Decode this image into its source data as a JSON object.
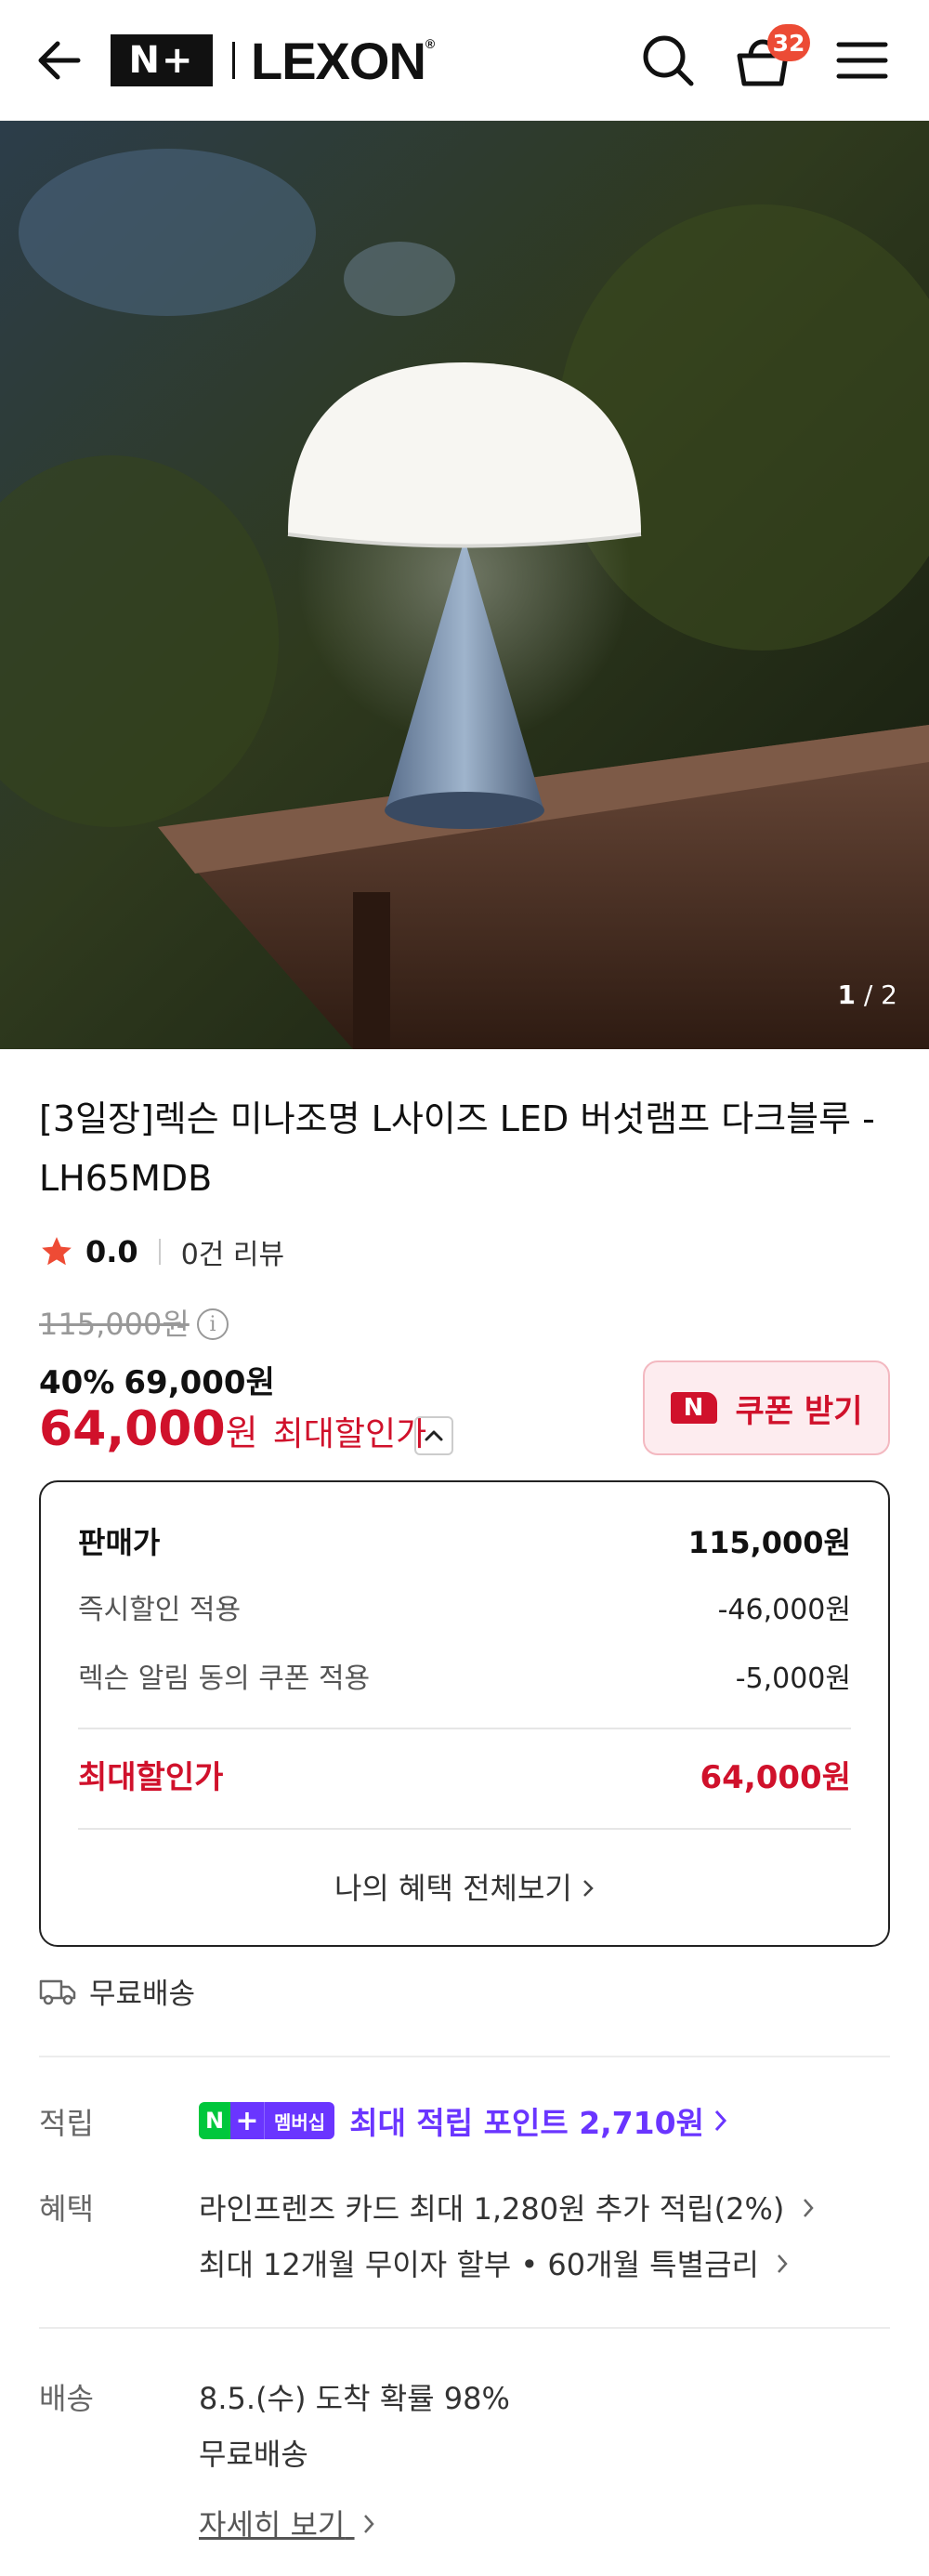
{
  "header": {
    "brand_np": "N+",
    "brand_name": "LEXON",
    "brand_reg": "®",
    "cart_count": "32",
    "icons": [
      "back-arrow-icon",
      "search-icon",
      "cart-basket-icon",
      "hamburger-menu-icon"
    ]
  },
  "hero": {
    "pager_current": "1",
    "pager_sep": "/",
    "pager_total": "2"
  },
  "product": {
    "title": "[3일장]렉슨 미나조명 L사이즈 LED 버섯램프 다크블루 - LH65MDB",
    "rating_score": "0.0",
    "review_count": "0건 리뷰",
    "original_price": "115,000원",
    "discount_pct": "40%",
    "sale_price": "69,000원",
    "max_price_amount": "64,000",
    "max_price_won": "원",
    "max_price_label": "최대할인가",
    "coupon_badge": "N",
    "coupon_button": "쿠폰 받기"
  },
  "breakdown": {
    "rows": [
      {
        "label": "판매가",
        "value": "115,000원"
      },
      {
        "label": "즉시할인 적용",
        "value": "-46,000원"
      },
      {
        "label": "렉슨 알림 동의 쿠폰 적용",
        "value": "-5,000원"
      },
      {
        "label": "최대할인가",
        "value": "64,000원"
      }
    ],
    "benefits_link": "나의 혜택 전체보기"
  },
  "shipping_badge": "무료배송",
  "points": {
    "label": "적립",
    "badge_n": "N",
    "badge_plus": "+",
    "badge_member": "멤버십",
    "text": "최대 적립 포인트 2,710원"
  },
  "benefits": {
    "label": "혜택",
    "lines": [
      "라인프렌즈 카드 최대 1,280원 추가 적립(2%)",
      "최대 12개월 무이자 할부 • 60개월 특별금리"
    ]
  },
  "delivery": {
    "label": "배송",
    "arrival": "8.5.(수) 도착 확률 98%",
    "fee": "무료배송",
    "detail_link": "자세히 보기"
  },
  "colors": {
    "accent_red": "#d0112b",
    "badge_orange": "#ec4b35",
    "naver_green": "#00c73c",
    "membership_purple": "#6a35ff",
    "star": "#ee4b35"
  }
}
